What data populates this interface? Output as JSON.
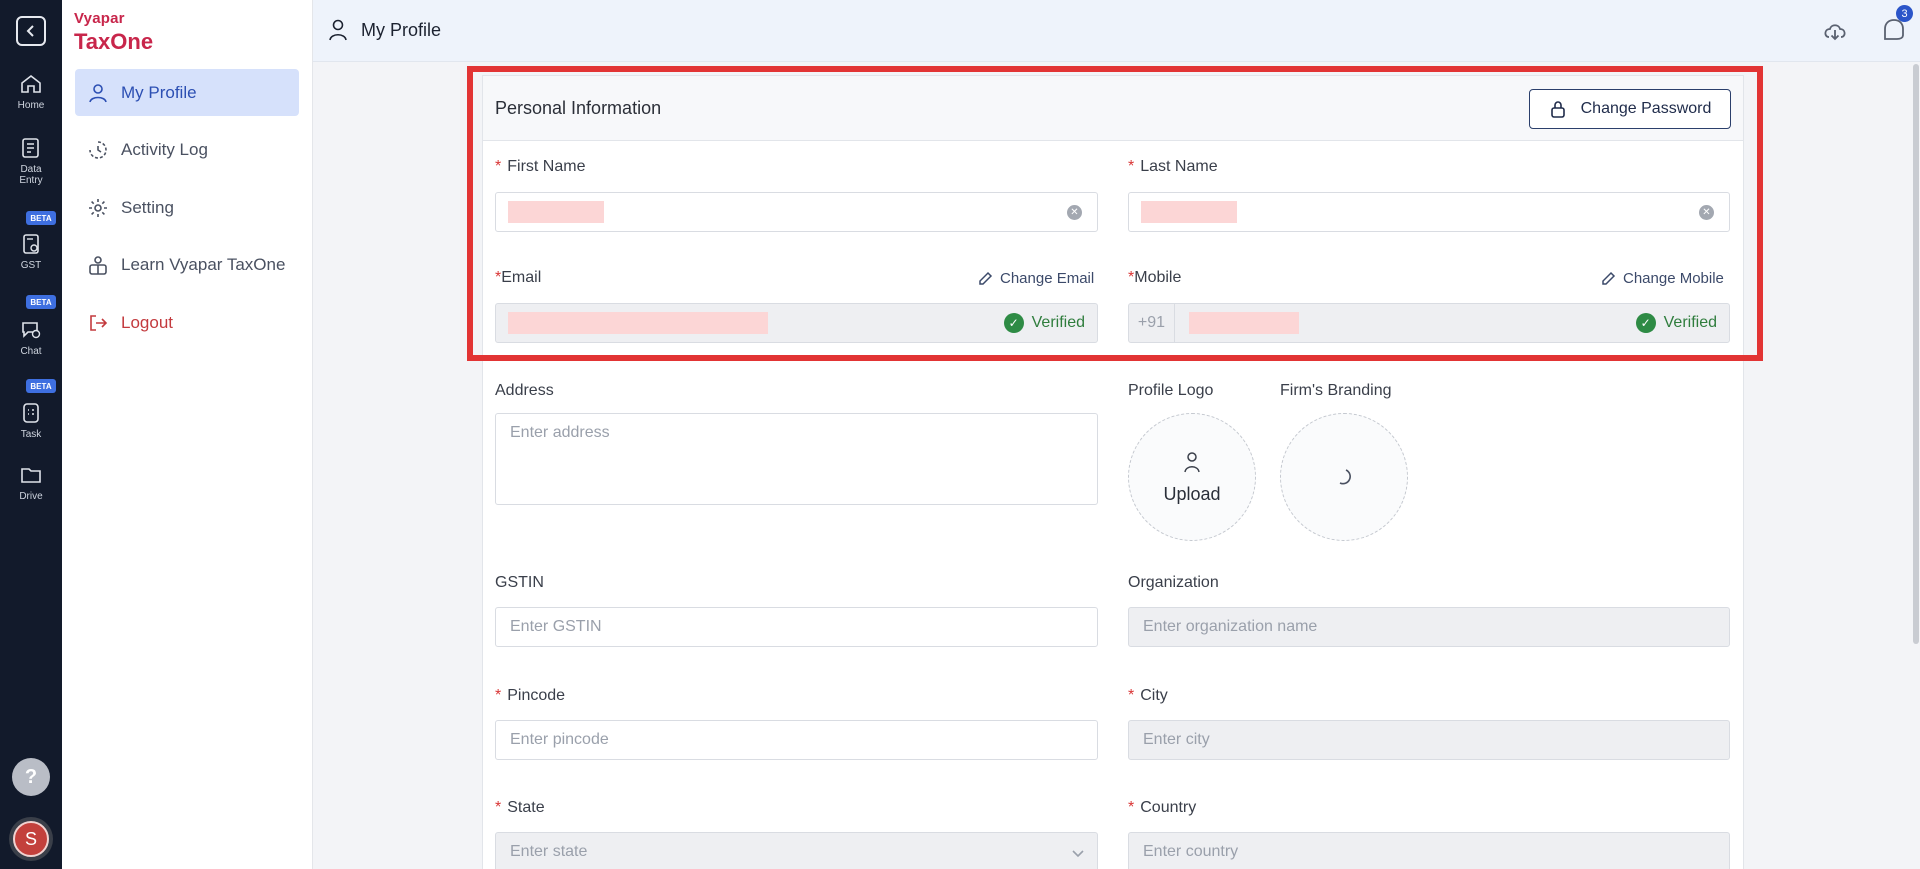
{
  "rail": {
    "items": [
      {
        "label": "Home",
        "icon": "home-icon"
      },
      {
        "label": "Data Entry",
        "icon": "data-entry-icon"
      },
      {
        "label": "GST",
        "icon": "gst-icon",
        "badge": "BETA"
      },
      {
        "label": "Chat",
        "icon": "chat-icon",
        "badge": "BETA"
      },
      {
        "label": "Task",
        "icon": "task-icon",
        "badge": "BETA"
      },
      {
        "label": "Drive",
        "icon": "folder-icon"
      }
    ],
    "help": "?",
    "avatar_initial": "S"
  },
  "brand": {
    "line1": "Vyapar",
    "line2": "TaxOne"
  },
  "sidebar": {
    "items": [
      {
        "label": "My Profile"
      },
      {
        "label": "Activity Log"
      },
      {
        "label": "Setting"
      },
      {
        "label": "Learn Vyapar TaxOne"
      },
      {
        "label": "Logout"
      }
    ]
  },
  "topbar": {
    "title": "My Profile",
    "notification_count": "3"
  },
  "card": {
    "title": "Personal Information",
    "change_password": "Change Password"
  },
  "form": {
    "first_name": {
      "label": "First Name"
    },
    "last_name": {
      "label": "Last Name"
    },
    "email": {
      "label": "Email",
      "action": "Change Email",
      "status": "Verified"
    },
    "mobile": {
      "label": "Mobile",
      "action": "Change Mobile",
      "prefix": "+91",
      "status": "Verified"
    },
    "address": {
      "label": "Address",
      "placeholder": "Enter address"
    },
    "profile_logo": {
      "label": "Profile Logo",
      "action": "Upload"
    },
    "firm_branding": {
      "label": "Firm's Branding"
    },
    "gstin": {
      "label": "GSTIN",
      "placeholder": "Enter GSTIN"
    },
    "organization": {
      "label": "Organization",
      "placeholder": "Enter organization name"
    },
    "pincode": {
      "label": "Pincode",
      "placeholder": "Enter pincode"
    },
    "city": {
      "label": "City",
      "placeholder": "Enter city"
    },
    "state": {
      "label": "State",
      "placeholder": "Enter state"
    },
    "country": {
      "label": "Country",
      "placeholder": "Enter country"
    }
  },
  "colors": {
    "accent": "#2c4fb3",
    "brand": "#c8264b",
    "highlight": "#e23434",
    "verified": "#2e8b45"
  }
}
